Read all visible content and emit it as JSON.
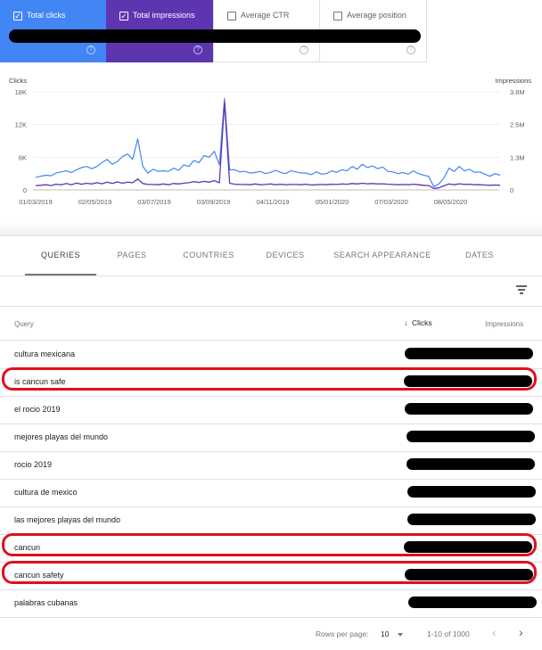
{
  "metrics": [
    {
      "label": "Total clicks",
      "checked": true,
      "check": "✓"
    },
    {
      "label": "Total impressions",
      "checked": true,
      "check": "✓"
    },
    {
      "label": "Average CTR",
      "checked": false,
      "check": ""
    },
    {
      "label": "Average position",
      "checked": false,
      "check": ""
    }
  ],
  "help_glyph": "?",
  "chart_data": {
    "type": "line",
    "ylabel_left": "Clicks",
    "ylabel_right": "Impressions",
    "left_ticks": [
      "18K",
      "12K",
      "6K",
      "0"
    ],
    "right_ticks": [
      "3.8M",
      "2.5M",
      "1.3M",
      "0"
    ],
    "left_range": [
      0,
      18000
    ],
    "right_range": [
      0,
      3800000
    ],
    "x_ticks": [
      "01/03/2019",
      "02/05/2019",
      "03/07/2019",
      "03/09/2019",
      "04/11/2019",
      "05/01/2020",
      "07/03/2020",
      "08/05/2020"
    ],
    "grid": true,
    "series": [
      {
        "color": "#4285f4",
        "axis": "left",
        "values": [
          2300,
          2500,
          2700,
          2600,
          3100,
          3300,
          3500,
          3200,
          3700,
          4100,
          4300,
          3900,
          4300,
          5000,
          5600,
          4700,
          5200,
          6100,
          6600,
          5600,
          9400,
          4300,
          3100,
          3800,
          3400,
          3500,
          3400,
          4000,
          3600,
          4600,
          4300,
          5400,
          5000,
          6300,
          6000,
          7100,
          4600,
          16800,
          3700,
          3700,
          3300,
          3400,
          3100,
          3200,
          3400,
          3000,
          3200,
          3600,
          3200,
          3000,
          3500,
          3300,
          3100,
          3100,
          2800,
          3300,
          2900,
          3000,
          3500,
          3200,
          3700,
          3500,
          4300,
          3800,
          4700,
          4100,
          4400,
          3900,
          4200,
          3400,
          3300,
          3000,
          3200,
          2900,
          3500,
          3000,
          2700,
          2500,
          600,
          1100,
          2200,
          4000,
          3400,
          4300,
          3500,
          3800,
          3200,
          3300,
          2900,
          2500,
          3000,
          2700
        ]
      },
      {
        "color": "#5e35b1",
        "axis": "right",
        "values": [
          170000,
          180000,
          200000,
          170000,
          220000,
          200000,
          250000,
          200000,
          270000,
          220000,
          260000,
          230000,
          280000,
          240000,
          300000,
          250000,
          310000,
          260000,
          300000,
          280000,
          420000,
          250000,
          210000,
          210000,
          200000,
          230000,
          200000,
          250000,
          230000,
          260000,
          280000,
          320000,
          290000,
          330000,
          300000,
          360000,
          280000,
          3400000,
          260000,
          220000,
          210000,
          210000,
          200000,
          230000,
          200000,
          210000,
          230000,
          200000,
          220000,
          200000,
          210000,
          210000,
          200000,
          220000,
          190000,
          200000,
          210000,
          200000,
          220000,
          210000,
          230000,
          220000,
          250000,
          230000,
          260000,
          240000,
          250000,
          230000,
          240000,
          220000,
          210000,
          200000,
          210000,
          200000,
          220000,
          200000,
          180000,
          170000,
          60000,
          80000,
          160000,
          230000,
          200000,
          240000,
          210000,
          220000,
          200000,
          200000,
          190000,
          180000,
          190000,
          180000
        ]
      }
    ]
  },
  "tabs": [
    "QUERIES",
    "PAGES",
    "COUNTRIES",
    "DEVICES",
    "SEARCH APPEARANCE",
    "DATES"
  ],
  "table": {
    "headers": {
      "query": "Query",
      "clicks": "Clicks",
      "impressions": "Impressions",
      "sort_arrow": "↓"
    },
    "rows": [
      {
        "query": "cultura mexicana",
        "highlighted": false
      },
      {
        "query": "is cancun safe",
        "highlighted": true
      },
      {
        "query": "el rocio 2019",
        "highlighted": false
      },
      {
        "query": "mejores playas del mundo",
        "highlighted": false
      },
      {
        "query": "rocio 2019",
        "highlighted": false
      },
      {
        "query": "cultura de mexico",
        "highlighted": false
      },
      {
        "query": "las mejores playas del mundo",
        "highlighted": false
      },
      {
        "query": "cancun",
        "highlighted": true
      },
      {
        "query": "cancun safety",
        "highlighted": true
      },
      {
        "query": "palabras cubanas",
        "highlighted": false
      }
    ]
  },
  "pagination": {
    "rows_label": "Rows per page:",
    "rows_value": "10",
    "range": "1-10 of 1000",
    "prev": "‹",
    "next": "›"
  },
  "colors": {
    "clicks": "#4285f4",
    "impressions": "#5e35b1",
    "highlight": "#e0101e"
  }
}
